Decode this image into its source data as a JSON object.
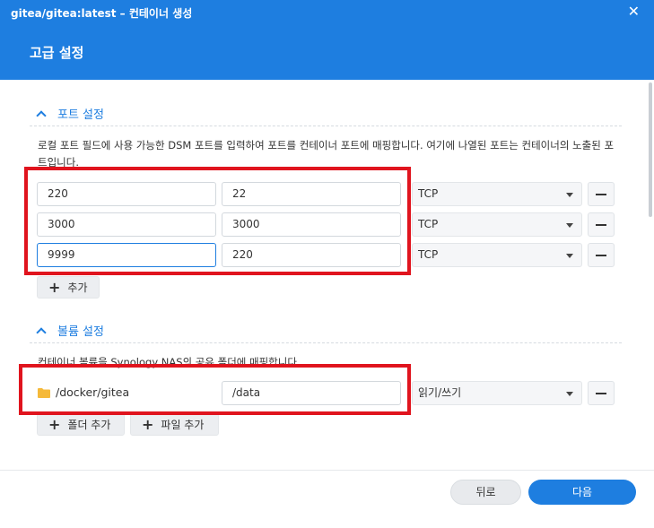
{
  "window": {
    "title": "gitea/gitea:latest – 컨테이너 생성",
    "close_glyph": "✕"
  },
  "header": {
    "title": "고급 설정"
  },
  "ports": {
    "section_title": "포트 설정",
    "description": "로컬 포트 필드에 사용 가능한 DSM 포트를 입력하여 포트를 컨테이너 포트에 매핑합니다. 여기에 나열된 포트는 컨테이너의 노출된 포트입니다.",
    "rows": [
      {
        "local": "220",
        "container": "22",
        "protocol": "TCP"
      },
      {
        "local": "3000",
        "container": "3000",
        "protocol": "TCP"
      },
      {
        "local": "9999",
        "container": "220",
        "protocol": "TCP"
      }
    ],
    "add_label": "추가"
  },
  "volumes": {
    "section_title": "볼륨 설정",
    "description": "컨테이너 볼륨을 Synology NAS의 공유 폴더에 매핑합니다.",
    "rows": [
      {
        "folder": "/docker/gitea",
        "mount": "/data",
        "mode": "읽기/쓰기"
      }
    ],
    "add_folder_label": "폴더 추가",
    "add_file_label": "파일 추가"
  },
  "footer": {
    "back_label": "뒤로",
    "next_label": "다음"
  },
  "colors": {
    "accent": "#1e7ee0",
    "highlight": "#e0141e",
    "folder": "#f5b93a"
  }
}
